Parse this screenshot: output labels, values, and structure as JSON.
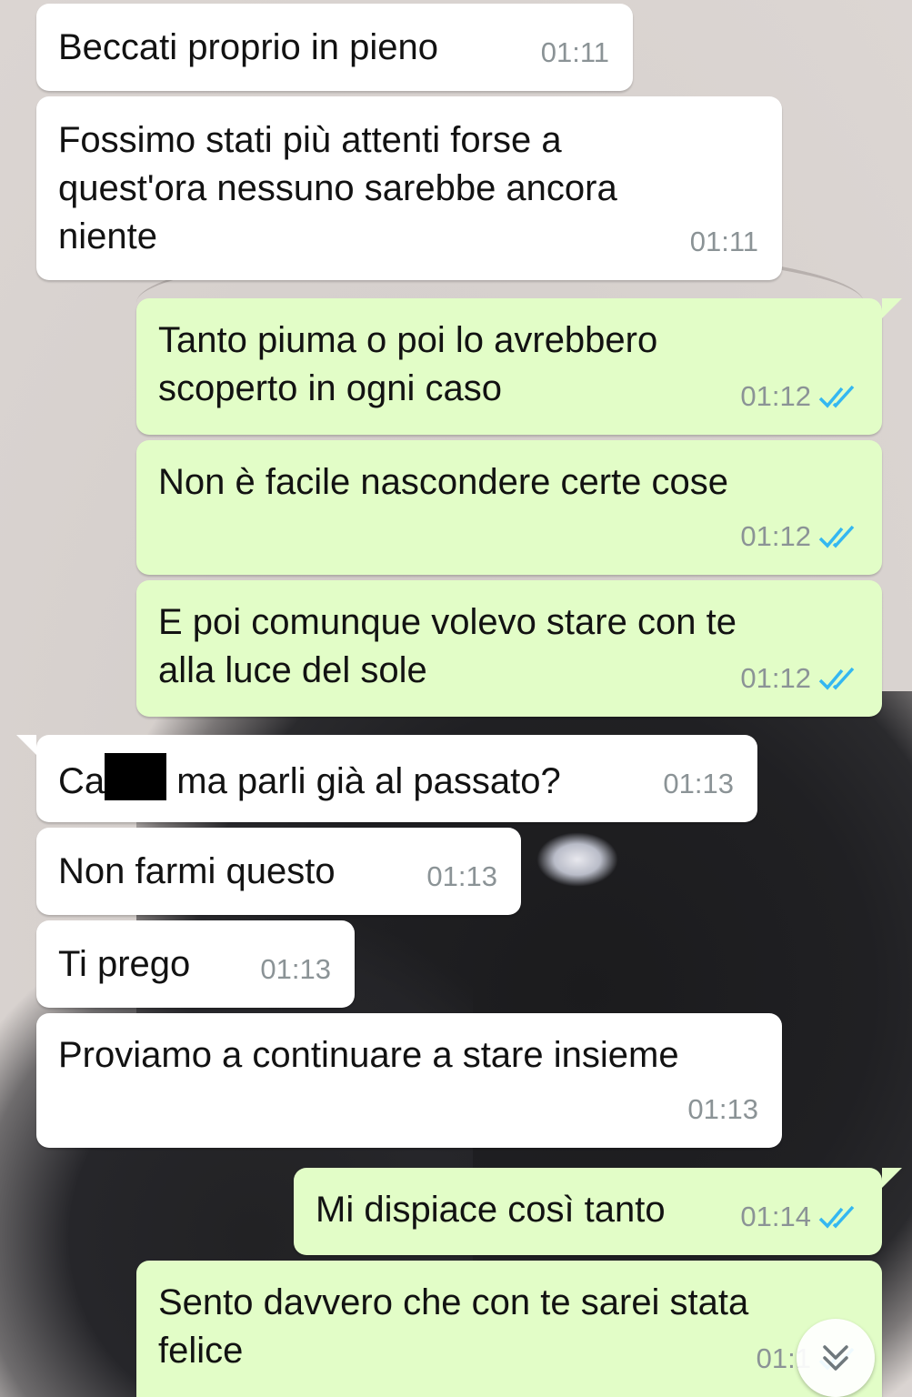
{
  "chat": {
    "messages": [
      {
        "direction": "in",
        "text": "Beccati proprio in pieno",
        "time": "01:11"
      },
      {
        "direction": "in",
        "text": "Fossimo stati più attenti forse a\nquest'ora nessuno sarebbe ancora\nniente",
        "time": "01:11"
      },
      {
        "direction": "out",
        "text": "Tanto piuma o poi lo avrebbero\nscoperto in ogni caso",
        "time": "01:12",
        "status": "read"
      },
      {
        "direction": "out",
        "text": "Non è facile nascondere certe cose",
        "time": "01:12",
        "status": "read"
      },
      {
        "direction": "out",
        "text": "E poi comunque volevo stare con te\nalla luce del sole",
        "time": "01:12",
        "status": "read"
      },
      {
        "direction": "in",
        "text_before": "Ca",
        "text_after": " ma parli già al passato?",
        "redacted": true,
        "time": "01:13"
      },
      {
        "direction": "in",
        "text": "Non farmi questo",
        "time": "01:13"
      },
      {
        "direction": "in",
        "text": "Ti prego",
        "time": "01:13"
      },
      {
        "direction": "in",
        "text": "Proviamo a continuare a stare insieme",
        "time": "01:13"
      },
      {
        "direction": "out",
        "text": "Mi dispiace così tanto",
        "time": "01:14",
        "status": "read"
      },
      {
        "direction": "out",
        "text": "Sento davvero che con te sarei stata\nfelice",
        "time": "01:1",
        "status": "read"
      }
    ]
  },
  "icons": {
    "read_tick": "double-check-icon",
    "scroll_down": "chevrons-down-icon"
  },
  "colors": {
    "incoming": "#ffffff",
    "outgoing": "#e2fdc7",
    "tick": "#34b7f1",
    "time": "#8b9396"
  }
}
